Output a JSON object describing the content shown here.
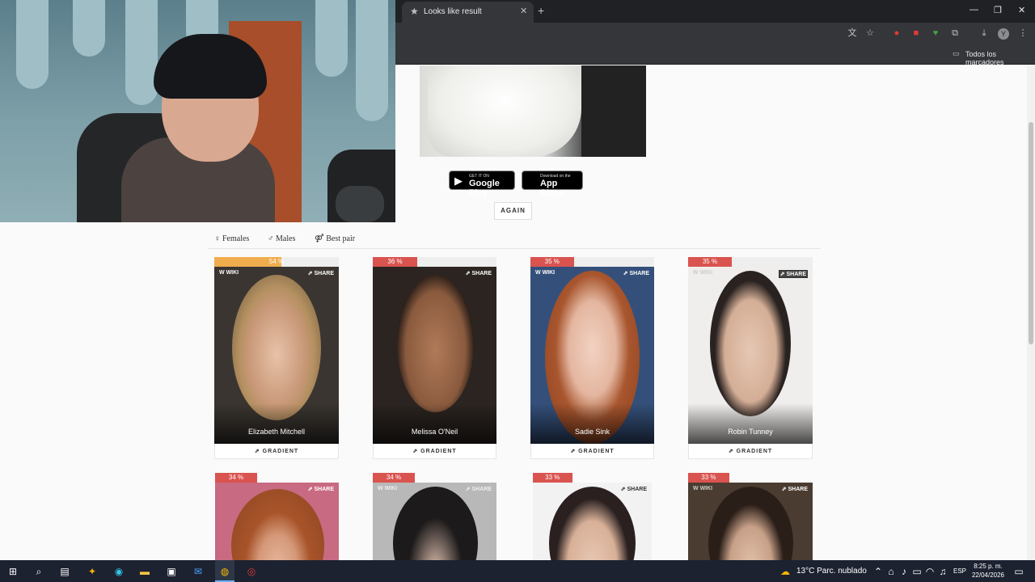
{
  "browser": {
    "tab_title": "Looks like result",
    "bookmarks_label": "Todos los marcadores"
  },
  "page": {
    "google_play_small": "GET IT ON",
    "google_play_big": "Google Play",
    "app_store_small": "Download on the",
    "app_store_big": "App Store",
    "again_label": "AGAIN",
    "filter_tabs": [
      "Females",
      "Males",
      "Best pair"
    ],
    "wiki_label": "WIKI",
    "share_label": "SHARE",
    "gradient_label": "GRADIENT",
    "cards": [
      {
        "percent": "54 %",
        "name": "Elizabeth Mitchell",
        "match": 0.54
      },
      {
        "percent": "36 %",
        "name": "Melissa O'Neil",
        "match": 0.36
      },
      {
        "percent": "35 %",
        "name": "Sadie Sink",
        "match": 0.35
      },
      {
        "percent": "35 %",
        "name": "Robin Tunney",
        "match": 0.35
      },
      {
        "percent": "34 %",
        "name": "",
        "match": 0.34
      },
      {
        "percent": "34 %",
        "name": "",
        "match": 0.34
      },
      {
        "percent": "33 %",
        "name": "",
        "match": 0.33
      },
      {
        "percent": "33 %",
        "name": "",
        "match": 0.33
      }
    ]
  },
  "taskbar": {
    "weather": "13°C  Parc. nublado",
    "language": "ESP",
    "time": "8:25 p. m.",
    "date": "22/04/2026"
  }
}
